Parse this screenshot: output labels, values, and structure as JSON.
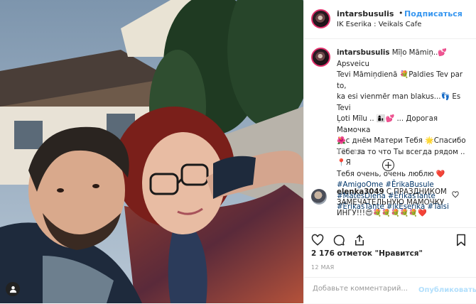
{
  "post": {
    "username": "intarsbusulis",
    "separator": "•",
    "follow_label": "Подписаться",
    "location": "IK Eserika : Veikals Cafe",
    "caption_lines": [
      "Mīļo Māmiņ..💕Apsveicu",
      "Tevi Māmiņdienā 💐Paldies Tev par to,",
      "ka esi vienmēr man blakus...👣 Es Tevi",
      "Ļoti Mīlu .. 👩‍👦💕 ... Дорогая Мамочка",
      "🌺с днём Матери Тебя 🌟Спасибо",
      "Тебе за то что Ты всегда рядом ..📍Я",
      "Тебя очень, очень люблю ❤️"
    ],
    "hashtags_lines": [
      "#AmigoOme #ĒrikaBusule",
      "#MātesDiena #ĒrikasTante",
      "#ĒrikasTante #ikEserika #Talsi"
    ],
    "caption_time": "12 нед.",
    "more_comments_symbol": "+",
    "comment": {
      "username": "elenka3049",
      "text_lines": [
        "С ПРАЗДНИКОМ",
        "ЗАМЕЧАТЕЛЬНУЮ МАМОЧКУ",
        "ИНГУ!!!😍💐💐💐💐💐❤️"
      ]
    },
    "likes": "2 176 отметок \"Нравится\"",
    "date": "12 МАЯ",
    "add_comment_placeholder": "Добавьте комментарий...",
    "publish_label": "Опубликовать"
  },
  "icons": {
    "like": "heart-icon",
    "comment": "comment-icon",
    "share": "share-icon",
    "save": "bookmark-icon",
    "user": "user-icon"
  },
  "colors": {
    "link_blue": "#3897f0",
    "hashtag": "#003569",
    "publish_disabled": "#b2dffc",
    "muted": "#999999"
  }
}
